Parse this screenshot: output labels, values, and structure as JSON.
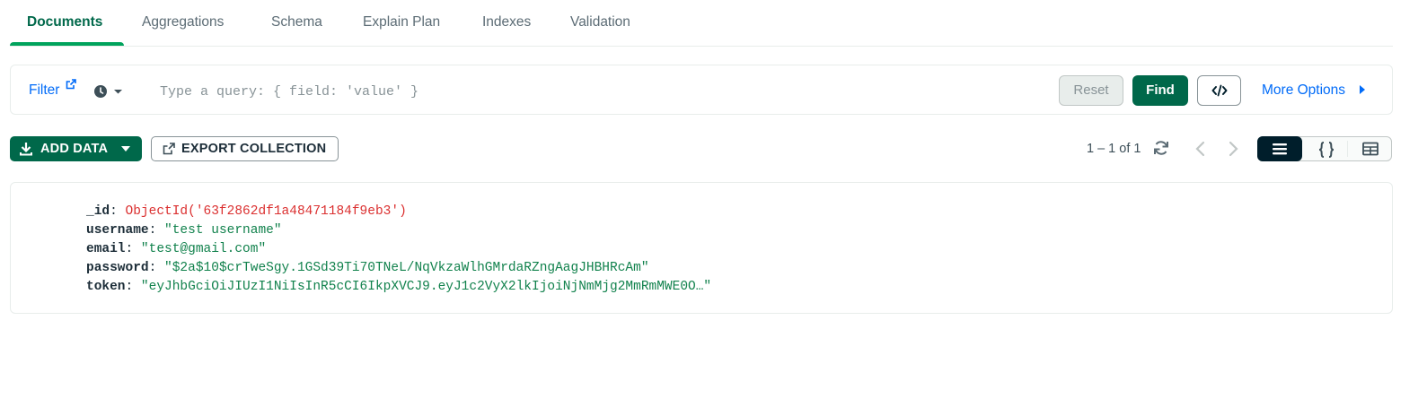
{
  "tabs": [
    {
      "label": "Documents",
      "active": true
    },
    {
      "label": "Aggregations",
      "active": false
    },
    {
      "label": "Schema",
      "active": false
    },
    {
      "label": "Explain Plan",
      "active": false
    },
    {
      "label": "Indexes",
      "active": false
    },
    {
      "label": "Validation",
      "active": false
    }
  ],
  "querybar": {
    "filter_label": "Filter",
    "placeholder": "Type a query: { field: 'value' }",
    "value": "",
    "reset_label": "Reset",
    "find_label": "Find",
    "more_options_label": "More Options"
  },
  "toolbar": {
    "add_data_label": "ADD DATA",
    "export_label": "EXPORT COLLECTION",
    "pagination_text": "1 – 1 of 1"
  },
  "document": {
    "fields": [
      {
        "key": "_id",
        "value": "ObjectId('63f2862df1a48471184f9eb3')",
        "type": "objectid"
      },
      {
        "key": "username",
        "value": "\"test username\"",
        "type": "string"
      },
      {
        "key": "email",
        "value": "\"test@gmail.com\"",
        "type": "string"
      },
      {
        "key": "password",
        "value": "\"$2a$10$crTweSgy.1GSd39Ti70TNeL/NqVkzaWlhGMrdaRZngAagJHBHRcAm\"",
        "type": "string"
      },
      {
        "key": "token",
        "value": "\"eyJhbGciOiJIUzI1NiIsInR5cCI6IkpXVCJ9.eyJ1c2VyX2lkIjoiNjNmMjg2MmRmMWE0O…\"",
        "type": "string"
      }
    ]
  },
  "colors": {
    "brand_green": "#00684a",
    "active_tab_underline": "#00a35c",
    "link_blue": "#016bf8",
    "objectid_red": "#db3030",
    "string_green": "#12824d",
    "active_view_bg": "#001e2b"
  },
  "icons": {
    "filter_external": "external-link-icon",
    "history": "clock-icon",
    "code": "code-brackets-icon",
    "add": "download-icon",
    "export": "export-icon",
    "refresh": "refresh-icon",
    "views": [
      "list-view-icon",
      "json-view-icon",
      "table-view-icon"
    ]
  }
}
